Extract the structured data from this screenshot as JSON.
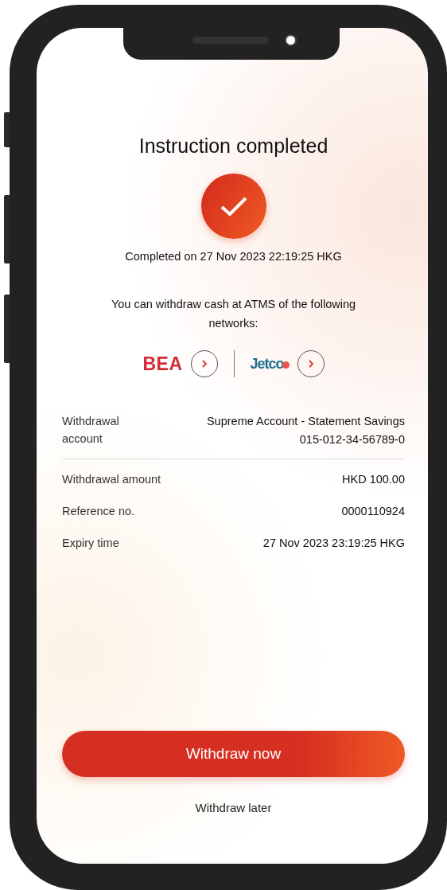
{
  "title": "Instruction completed",
  "completed_on": "Completed on 27 Nov 2023 22:19:25 HKG",
  "networks_note": "You can withdraw cash at ATMS of the following networks:",
  "networks": [
    {
      "kind": "bea",
      "name": "BEA",
      "color": "#d42a34"
    },
    {
      "kind": "jetco",
      "name": "Jetco",
      "color": "#1f6f8b"
    }
  ],
  "details": [
    {
      "label": "Withdrawal account",
      "values": [
        "Supreme Account - Statement Savings",
        "015-012-34-56789-0"
      ],
      "divider": true
    },
    {
      "label": "Withdrawal amount",
      "values": [
        "HKD 100.00"
      ],
      "divider": false
    },
    {
      "label": "Reference no.",
      "values": [
        "0000110924"
      ],
      "divider": false
    },
    {
      "label": "Expiry time",
      "values": [
        "27 Nov 2023 23:19:25 HKG"
      ],
      "divider": false
    }
  ],
  "primary_button": "Withdraw now",
  "secondary_link": "Withdraw later"
}
